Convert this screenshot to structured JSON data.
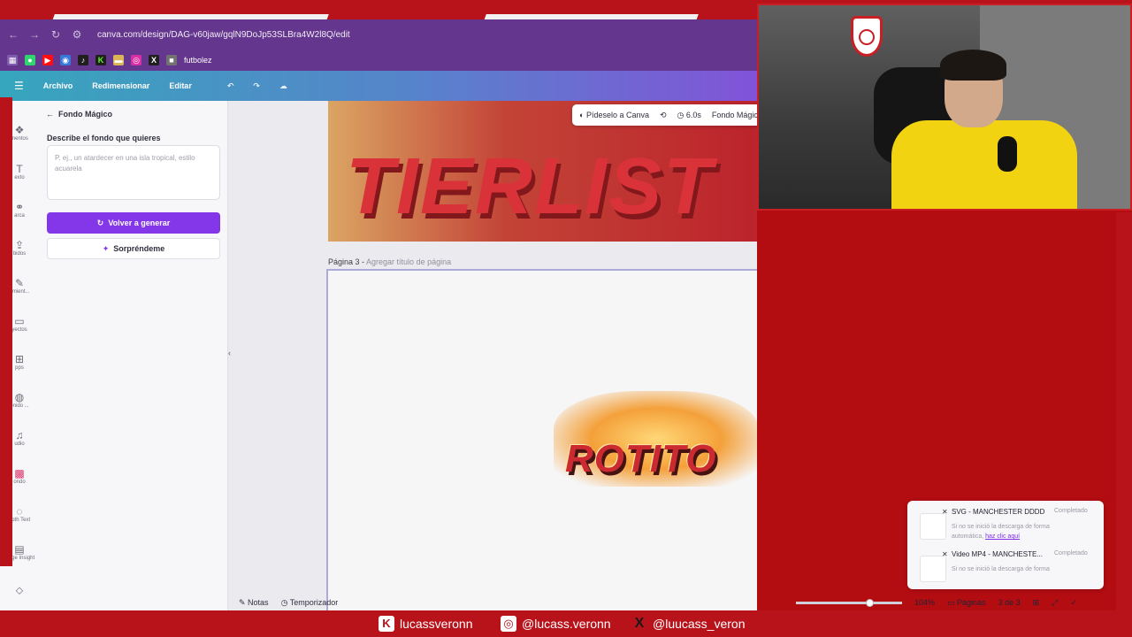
{
  "browser": {
    "url": "canva.com/design/DAG-v60jaw/gqlN9DoJp53SLBra4W2l8Q/edit",
    "bookmark_label": "futbolez"
  },
  "canva": {
    "menu_archivo": "Archivo",
    "menu_redimensionar": "Redimensionar",
    "menu_editar": "Editar"
  },
  "rail": [
    {
      "label": "mentos"
    },
    {
      "label": "exto"
    },
    {
      "label": "arca"
    },
    {
      "label": "bidos"
    },
    {
      "label": "amient..."
    },
    {
      "label": "yectos"
    },
    {
      "label": "pps"
    },
    {
      "label": "enido ..."
    },
    {
      "label": "udio"
    },
    {
      "label": "ondo"
    },
    {
      "label": "epth Text"
    },
    {
      "label": "mage Insight"
    }
  ],
  "panel": {
    "title": "Fondo Mágico",
    "label": "Describe el fondo que quieres",
    "placeholder": "P. ej., un atardecer en una isla tropical, estilo acuarela",
    "generate": "Volver a generar",
    "surprise": "Sorpréndeme"
  },
  "context_bar": {
    "ask": "Pídeselo a Canva",
    "duration": "6.0s",
    "magic": "Fondo Mágico"
  },
  "page2": {
    "text": "TIERLIST"
  },
  "page3": {
    "label": "Página 3 - ",
    "placeholder": "Agregar título de página",
    "logo_text": "ROTITO"
  },
  "downloads": [
    {
      "title": "SVG - MANCHESTER DDDD",
      "status": "Completado",
      "desc": "Si no se inició la descarga de forma automática, ",
      "link": "haz clic aquí"
    },
    {
      "title": "Video MP4 - MANCHESTE...",
      "status": "Completado",
      "desc": "Si no se inició la descarga de forma",
      "link": ""
    }
  ],
  "bottom": {
    "notes": "Notas",
    "timer": "Temporizador",
    "zoom": "104%",
    "pages": "Páginas",
    "page_count": "3 de 3"
  },
  "socials": {
    "kick": "lucassveronn",
    "instagram": "@lucass.veronn",
    "x": "@luucass_veron"
  }
}
